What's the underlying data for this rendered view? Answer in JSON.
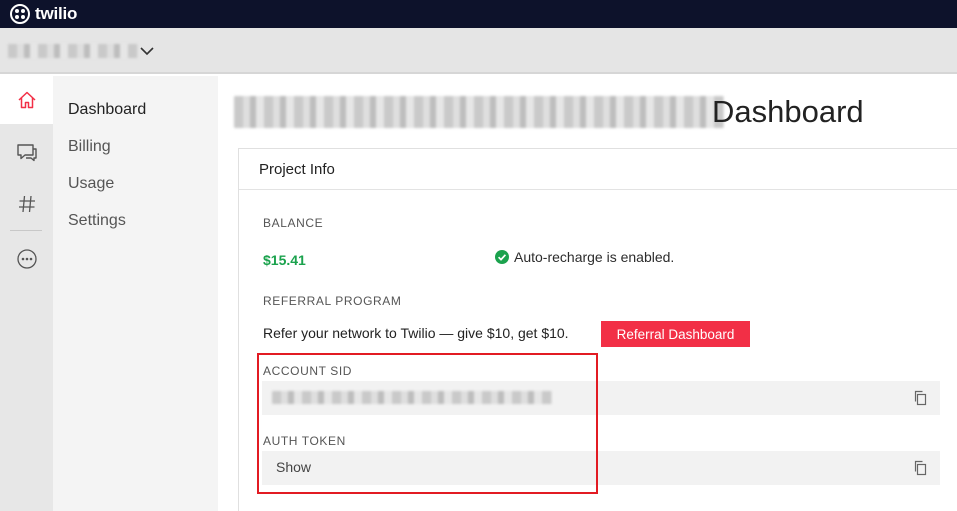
{
  "brand": {
    "name": "twilio"
  },
  "colors": {
    "topbar_bg": "#0d122b",
    "accent_red": "#f22f46",
    "balance_green": "#1ba24d",
    "highlight_red": "#e21b23"
  },
  "account_switcher": {
    "icon": "chevron-down-icon"
  },
  "icon_rail": [
    {
      "name": "home-icon",
      "active": true
    },
    {
      "name": "chat-bubbles-icon",
      "active": false
    },
    {
      "name": "hashtag-icon",
      "active": false
    },
    {
      "name": "more-ellipsis-icon",
      "active": false
    }
  ],
  "subnav": {
    "items": [
      "Dashboard",
      "Billing",
      "Usage",
      "Settings"
    ],
    "active": "Dashboard"
  },
  "page": {
    "title": "Dashboard"
  },
  "project_info": {
    "title": "Project Info",
    "balance_label": "BALANCE",
    "balance_value": "$15.41",
    "auto_recharge_text": "Auto-recharge is enabled.",
    "referral_label": "REFERRAL PROGRAM",
    "referral_text": "Refer your network to Twilio — give $10, get $10.",
    "referral_button": "Referral Dashboard",
    "account_sid_label": "ACCOUNT SID",
    "auth_token_label": "AUTH TOKEN",
    "auth_token_show": "Show"
  }
}
